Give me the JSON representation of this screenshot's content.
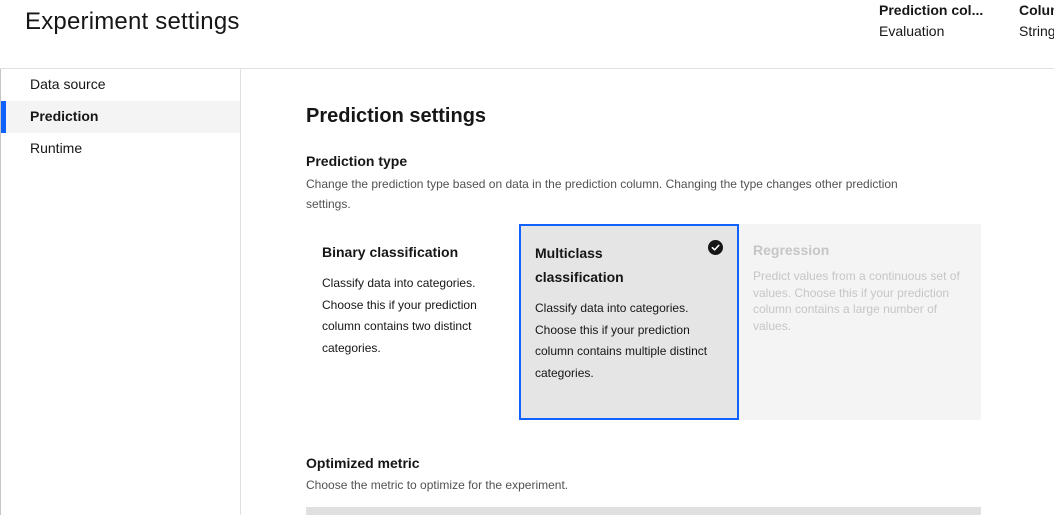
{
  "header": {
    "title": "Experiment settings",
    "meta": [
      {
        "label": "Prediction col...",
        "value": "Evaluation"
      },
      {
        "label": "Colum",
        "value": "String"
      }
    ]
  },
  "sidebar": {
    "items": [
      {
        "label": "Data source",
        "active": false
      },
      {
        "label": "Prediction",
        "active": true
      },
      {
        "label": "Runtime",
        "active": false
      }
    ]
  },
  "main": {
    "section_title": "Prediction settings",
    "prediction_type": {
      "heading": "Prediction type",
      "helper": "Change the prediction type based on data in the prediction column. Changing the type changes other prediction settings.",
      "tiles": [
        {
          "title": "Binary classification",
          "description": "Classify data into categories. Choose this if your prediction column contains two distinct categories.",
          "state": "default"
        },
        {
          "title": "Multiclass classification",
          "description": "Classify data into categories. Choose this if your prediction column contains multiple distinct categories.",
          "state": "selected"
        },
        {
          "title": "Regression",
          "description": "Predict values from a continuous set of values. Choose this if your prediction column contains a large number of values.",
          "state": "disabled"
        }
      ]
    },
    "optimized_metric": {
      "heading": "Optimized metric",
      "helper": "Choose the metric to optimize for the experiment."
    }
  },
  "colors": {
    "accent": "#0f62fe",
    "selected_tile_bg": "#e5e5e5",
    "disabled_tile_bg": "#f4f4f4",
    "disabled_text": "#c6c6c6"
  }
}
